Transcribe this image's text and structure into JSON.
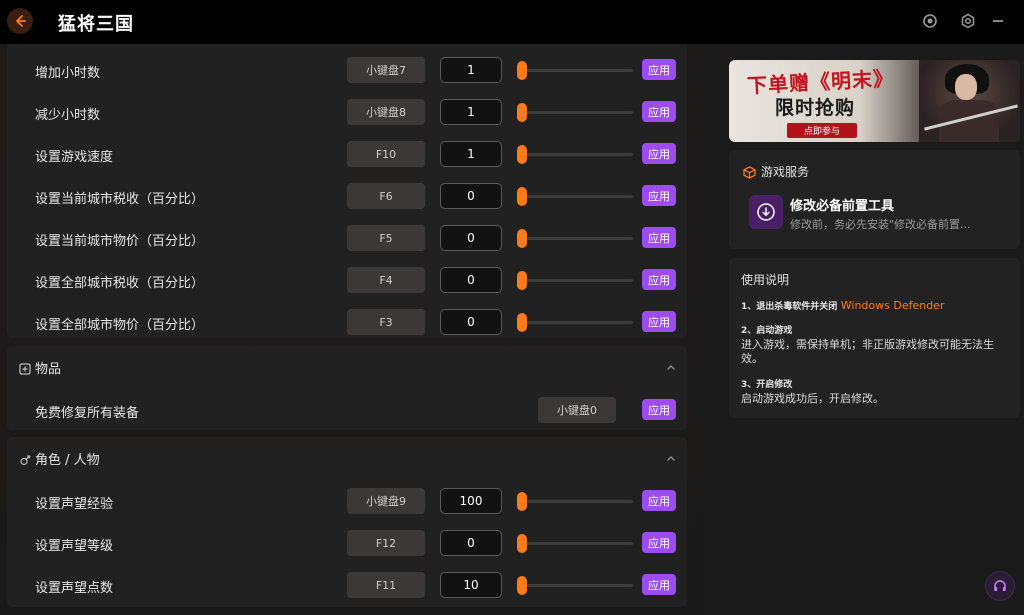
{
  "app": {
    "title": "猛将三国"
  },
  "sections": {
    "top_rows": [
      {
        "label": "增加小时数",
        "hotkey": "小键盘7",
        "value": "1",
        "level": 0,
        "apply": "应用"
      },
      {
        "label": "减少小时数",
        "hotkey": "小键盘8",
        "value": "1",
        "level": 0,
        "apply": "应用"
      },
      {
        "label": "设置游戏速度",
        "hotkey": "F10",
        "value": "1",
        "level": 0,
        "apply": "应用"
      },
      {
        "label": "设置当前城市税收（百分比）",
        "hotkey": "F6",
        "value": "0",
        "level": 0,
        "apply": "应用"
      },
      {
        "label": "设置当前城市物价（百分比）",
        "hotkey": "F5",
        "value": "0",
        "level": 0,
        "apply": "应用"
      },
      {
        "label": "设置全部城市税收（百分比）",
        "hotkey": "F4",
        "value": "0",
        "level": 0,
        "apply": "应用"
      },
      {
        "label": "设置全部城市物价（百分比）",
        "hotkey": "F3",
        "value": "0",
        "level": 0,
        "apply": "应用"
      }
    ],
    "items": {
      "title": "物品",
      "rows": [
        {
          "label": "免费修复所有装备",
          "hotkey": "小键盘0",
          "apply": "应用"
        }
      ]
    },
    "roles": {
      "title": "角色 / 人物",
      "rows": [
        {
          "label": "设置声望经验",
          "hotkey": "小键盘9",
          "value": "100",
          "level": 0,
          "apply": "应用"
        },
        {
          "label": "设置声望等级",
          "hotkey": "F12",
          "value": "0",
          "level": 0,
          "apply": "应用"
        },
        {
          "label": "设置声望点数",
          "hotkey": "F11",
          "value": "10",
          "level": 0,
          "apply": "应用"
        }
      ]
    }
  },
  "banner": {
    "title": "下单赠《明末》",
    "subtitle": "限时抢购",
    "button": "点即参与"
  },
  "service": {
    "label": "游戏服务",
    "tool_title": "修改必备前置工具",
    "tool_desc": "修改前，务必先安装\"修改必备前置..."
  },
  "guide": {
    "title": "使用说明",
    "step1_title": "1、退出杀毒软件并关闭",
    "step1_accent": "Windows Defender",
    "step2_title": "2、启动游戏",
    "step2_text": "进入游戏，需保持单机；非正版游戏修改可能无法生效。",
    "step3_title": "3、开启修改",
    "step3_text": "启动游戏成功后，开启修改。"
  },
  "colors": {
    "accent": "#ff7a1a",
    "apply": "#9d4cf0",
    "background": "#171717"
  }
}
